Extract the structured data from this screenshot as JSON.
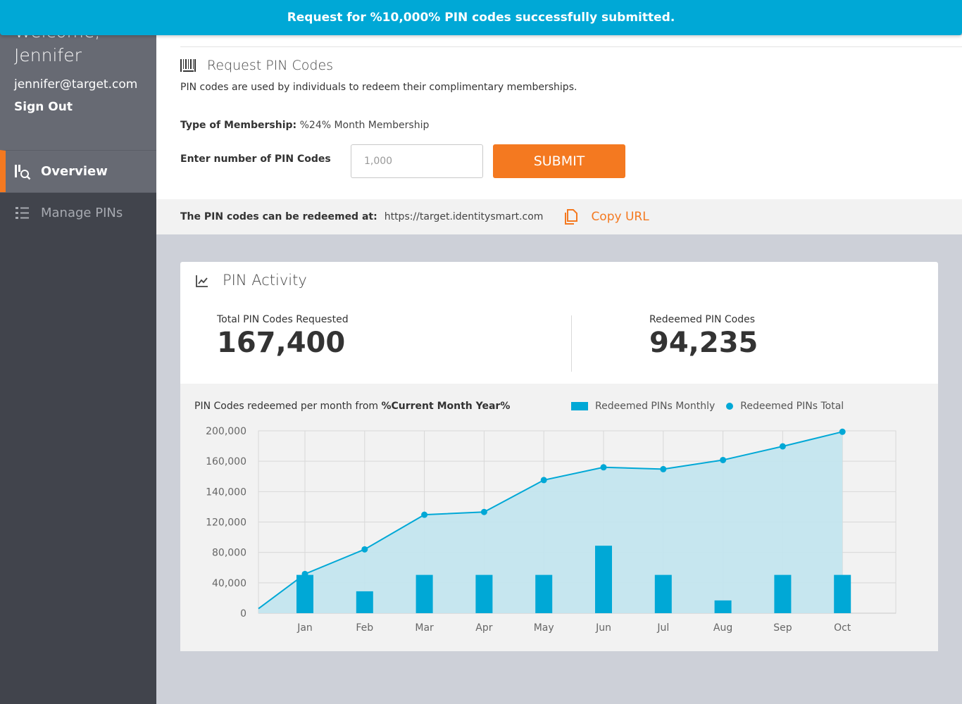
{
  "banner": {
    "message": "Request for %10,000% PIN codes successfully submitted."
  },
  "sidebar": {
    "welcome": "Welcome,",
    "name": "Jennifer",
    "email": "jennifer@target.com",
    "sign_out": "Sign Out",
    "items": [
      {
        "label": "Overview",
        "icon": "overview-search-icon",
        "active": true
      },
      {
        "label": "Manage PINs",
        "icon": "list-icon",
        "active": false
      }
    ]
  },
  "request": {
    "title": "Request PIN Codes",
    "title_icon": "barcode-icon",
    "description": "PIN codes are used by individuals to redeem their complimentary memberships.",
    "type_label": "Type of Membership:",
    "type_value": "%24% Month Membership",
    "count_label": "Enter number of PIN Codes",
    "count_placeholder": "1,000",
    "submit_label": "SUBMIT"
  },
  "redeem": {
    "label": "The PIN codes can be redeemed at:",
    "url": "https://target.identitysmart.com",
    "copy_label": "Copy URL",
    "copy_icon": "copy-icon"
  },
  "activity": {
    "title": "PIN Activity",
    "title_icon": "line-chart-icon",
    "total_label": "Total PIN Codes Requested",
    "total_value": "167,400",
    "redeemed_label": "Redeemed PIN Codes",
    "redeemed_value": "94,235",
    "caption_prefix": "PIN Codes redeemed per month from ",
    "caption_bold": "%Current Month Year%"
  },
  "chart_data": {
    "type": "bar",
    "categories": [
      "Jan",
      "Feb",
      "Mar",
      "Apr",
      "May",
      "Jun",
      "Jul",
      "Aug",
      "Sep",
      "Oct"
    ],
    "y_tick_labels": [
      "0",
      "40,000",
      "80,000",
      "120,000",
      "140,000",
      "160,000",
      "200,000"
    ],
    "series": [
      {
        "name": "Redeemed PINs Monthly",
        "kind": "bar",
        "color": "#00a8d6",
        "values": [
          42000,
          24000,
          42000,
          42000,
          42000,
          74000,
          42000,
          14000,
          42000,
          42000
        ]
      },
      {
        "name": "Redeemed PINs Total",
        "kind": "line",
        "color": "#00a8d6",
        "area_fill": "#c3e5ee",
        "start_value": 5000,
        "values": [
          43000,
          70000,
          108000,
          111000,
          146000,
          160000,
          158000,
          168000,
          183000,
          199000
        ]
      }
    ],
    "grid": true,
    "legend": "top-right"
  },
  "colors": {
    "accent": "#00a8d6",
    "action": "#f47920",
    "sidebar": "#41444c"
  }
}
